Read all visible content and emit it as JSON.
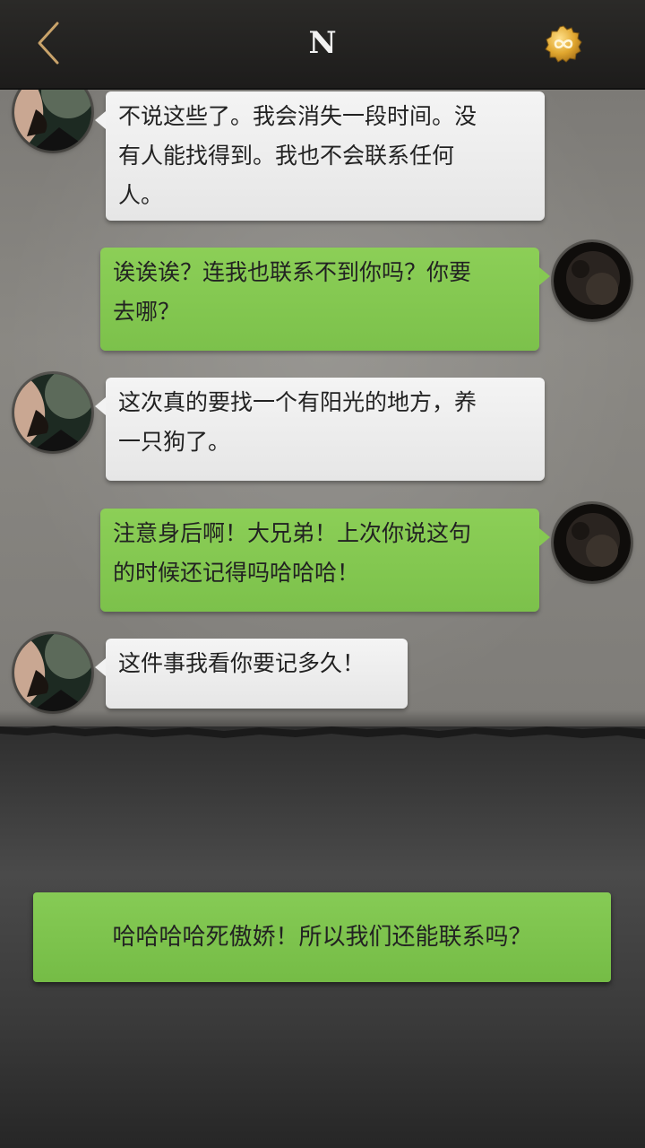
{
  "header": {
    "title": "N",
    "back_icon": "chevron-left-icon",
    "right_icon": "infinity-coin-icon",
    "accent_color": "#c9a36a"
  },
  "messages": [
    {
      "side": "left",
      "text_lines": [
        "不说这些了。我会消失一段时间。没",
        "有人能找得到。我也不会联系任何",
        "人。"
      ]
    },
    {
      "side": "right",
      "text_lines": [
        "诶诶诶？连我也联系不到你吗？你要",
        "去哪？"
      ]
    },
    {
      "side": "left",
      "text_lines": [
        "这次真的要找一个有阳光的地方，养",
        "一只狗了。"
      ]
    },
    {
      "side": "right",
      "text_lines": [
        "注意身后啊！大兄弟！上次你说这句",
        "的时候还记得吗哈哈哈！"
      ]
    },
    {
      "side": "left",
      "text_lines": [
        "这件事我看你要记多久！"
      ]
    }
  ],
  "reply_option": {
    "label": "哈哈哈哈死傲娇！所以我们还能联系吗？"
  },
  "colors": {
    "bubble_green": "#80c54f",
    "bubble_gray": "#eeeeee",
    "chat_background": "#858380",
    "bottom_background": "#3d3d3d"
  }
}
